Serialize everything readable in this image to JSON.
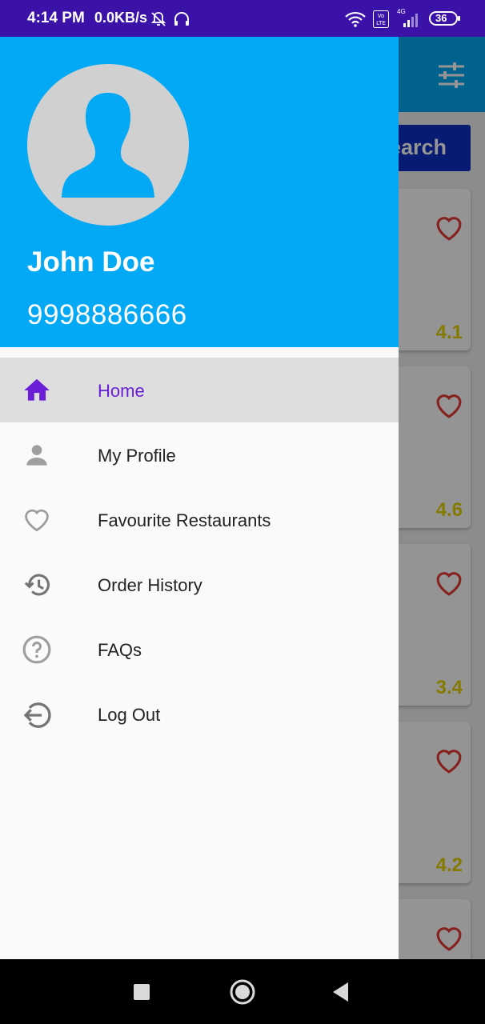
{
  "status_bar": {
    "time": "4:14 PM",
    "speed": "0.0KB/s",
    "battery": "36",
    "network": "4G",
    "icons": [
      "mute-bell-icon",
      "headphones-icon",
      "wifi-icon",
      "volte-icon",
      "signal-icon",
      "battery-icon"
    ]
  },
  "background_app": {
    "search_label": "earch",
    "ratings": [
      "4.1",
      "4.6",
      "3.4",
      "4.2"
    ],
    "colors": {
      "toolbar": "#03a9f4",
      "search": "#0d2fc6",
      "rating": "#e5d300",
      "heart": "#e53935"
    }
  },
  "drawer": {
    "user_name": "John Doe",
    "user_phone": "9998886666",
    "menu": [
      {
        "label": "Home",
        "icon": "home-icon",
        "selected": true
      },
      {
        "label": "My Profile",
        "icon": "person-icon",
        "selected": false
      },
      {
        "label": "Favourite Restaurants",
        "icon": "heart-outline-icon",
        "selected": false
      },
      {
        "label": "Order History",
        "icon": "history-icon",
        "selected": false
      },
      {
        "label": "FAQs",
        "icon": "help-circle-icon",
        "selected": false
      },
      {
        "label": "Log Out",
        "icon": "logout-icon",
        "selected": false
      }
    ],
    "colors": {
      "header": "#03a9f4",
      "accent": "#6a1fd6",
      "selected_bg": "#dedede"
    }
  },
  "nav_bar": {
    "buttons": [
      "recents-button",
      "home-button",
      "back-button"
    ]
  }
}
